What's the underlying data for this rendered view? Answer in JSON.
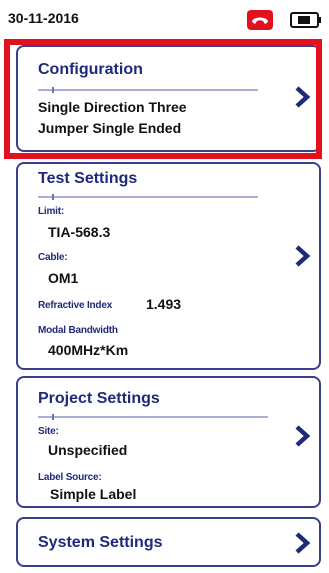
{
  "status_bar": {
    "date": "30-11-2016",
    "phone_icon": "phone-hangup-icon",
    "battery_icon": "battery-icon"
  },
  "configuration": {
    "title": "Configuration",
    "description_line1": "Single Direction Three",
    "description_line2": "Jumper Single Ended"
  },
  "test_settings": {
    "title": "Test Settings",
    "limit_label": "Limit:",
    "limit_value": "TIA-568.3",
    "cable_label": "Cable:",
    "cable_value": "OM1",
    "refractive_label": "Refractive Index",
    "refractive_value": "1.493",
    "bandwidth_label": "Modal Bandwidth",
    "bandwidth_value": "400MHz*Km"
  },
  "project_settings": {
    "title": "Project Settings",
    "site_label": "Site:",
    "site_value": "Unspecified",
    "label_source_label": "Label Source:",
    "label_source_value": "Simple Label"
  },
  "system_settings": {
    "title": "System Settings"
  },
  "colors": {
    "accent": "#1f2a7a",
    "border": "#3a3f8f",
    "highlight": "#e3101d",
    "phone": "#e3101d"
  }
}
